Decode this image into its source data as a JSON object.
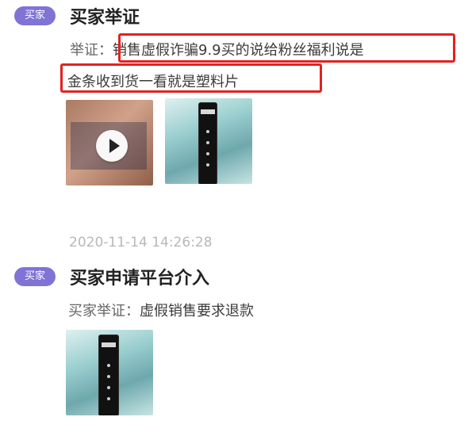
{
  "sections": [
    {
      "badge": "买家",
      "title": "买家举证",
      "line1_label": "举证：",
      "line1_text": "销售虚假诈骗9.9买的说给粉丝福利说是",
      "line2_text": "金条收到货一看就是塑料片"
    },
    {
      "timestamp": "2020-11-14 14:26:28",
      "badge": "买家",
      "title": "买家申请平台介入",
      "line_label": "买家举证：",
      "line_text": "虚假销售要求退款"
    }
  ],
  "colors": {
    "badge": "#7f73d6",
    "highlight": "#e22222",
    "timestamp": "#b8b8b8"
  },
  "icons": {
    "play": "play-icon"
  }
}
